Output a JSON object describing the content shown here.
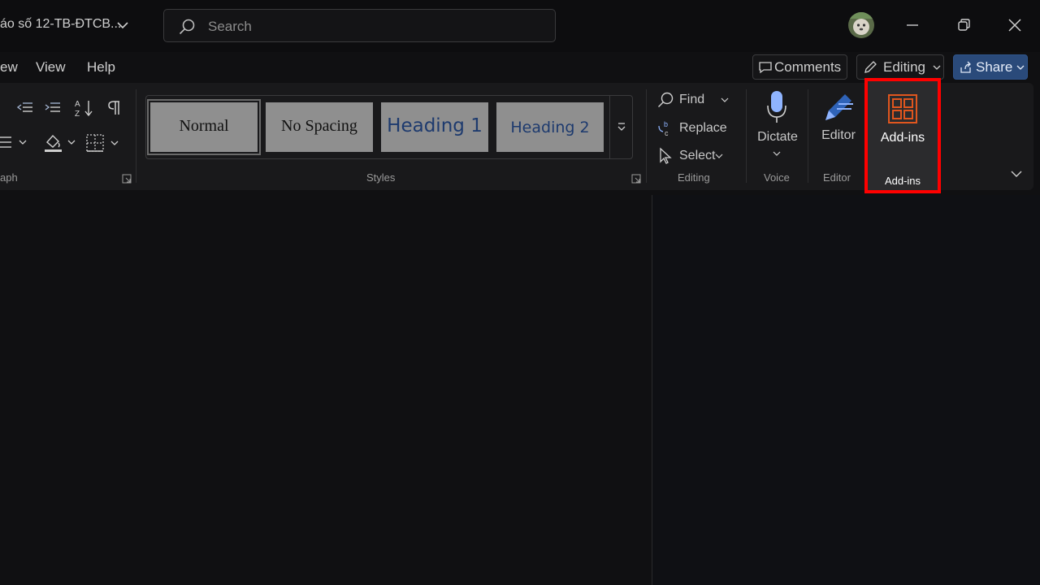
{
  "window": {
    "doc_title": "áo số 12-TB-ĐTCB...",
    "search_placeholder": "Search"
  },
  "tabs": [
    {
      "label": "ew"
    },
    {
      "label": "View"
    },
    {
      "label": "Help"
    }
  ],
  "header_actions": {
    "comments": "Comments",
    "editing": "Editing",
    "share": "Share"
  },
  "ribbon": {
    "paragraph_group_label": "aph",
    "styles": [
      {
        "label": "Normal"
      },
      {
        "label": "No Spacing"
      },
      {
        "label": "Heading 1"
      },
      {
        "label": "Heading 2"
      }
    ],
    "styles_group_label": "Styles",
    "editing": {
      "find": "Find",
      "replace": "Replace",
      "select": "Select",
      "group_label": "Editing"
    },
    "voice": {
      "dictate": "Dictate",
      "group_label": "Voice"
    },
    "editor": {
      "label": "Editor",
      "group_label": "Editor"
    },
    "addins": {
      "label": "Add-ins",
      "group_label": "Add-ins"
    }
  },
  "colors": {
    "highlight": "#ff0000",
    "addins_icon": "#e0561e",
    "share_accent": "#2a4a7a",
    "mic_accent": "#8fb4ff"
  }
}
